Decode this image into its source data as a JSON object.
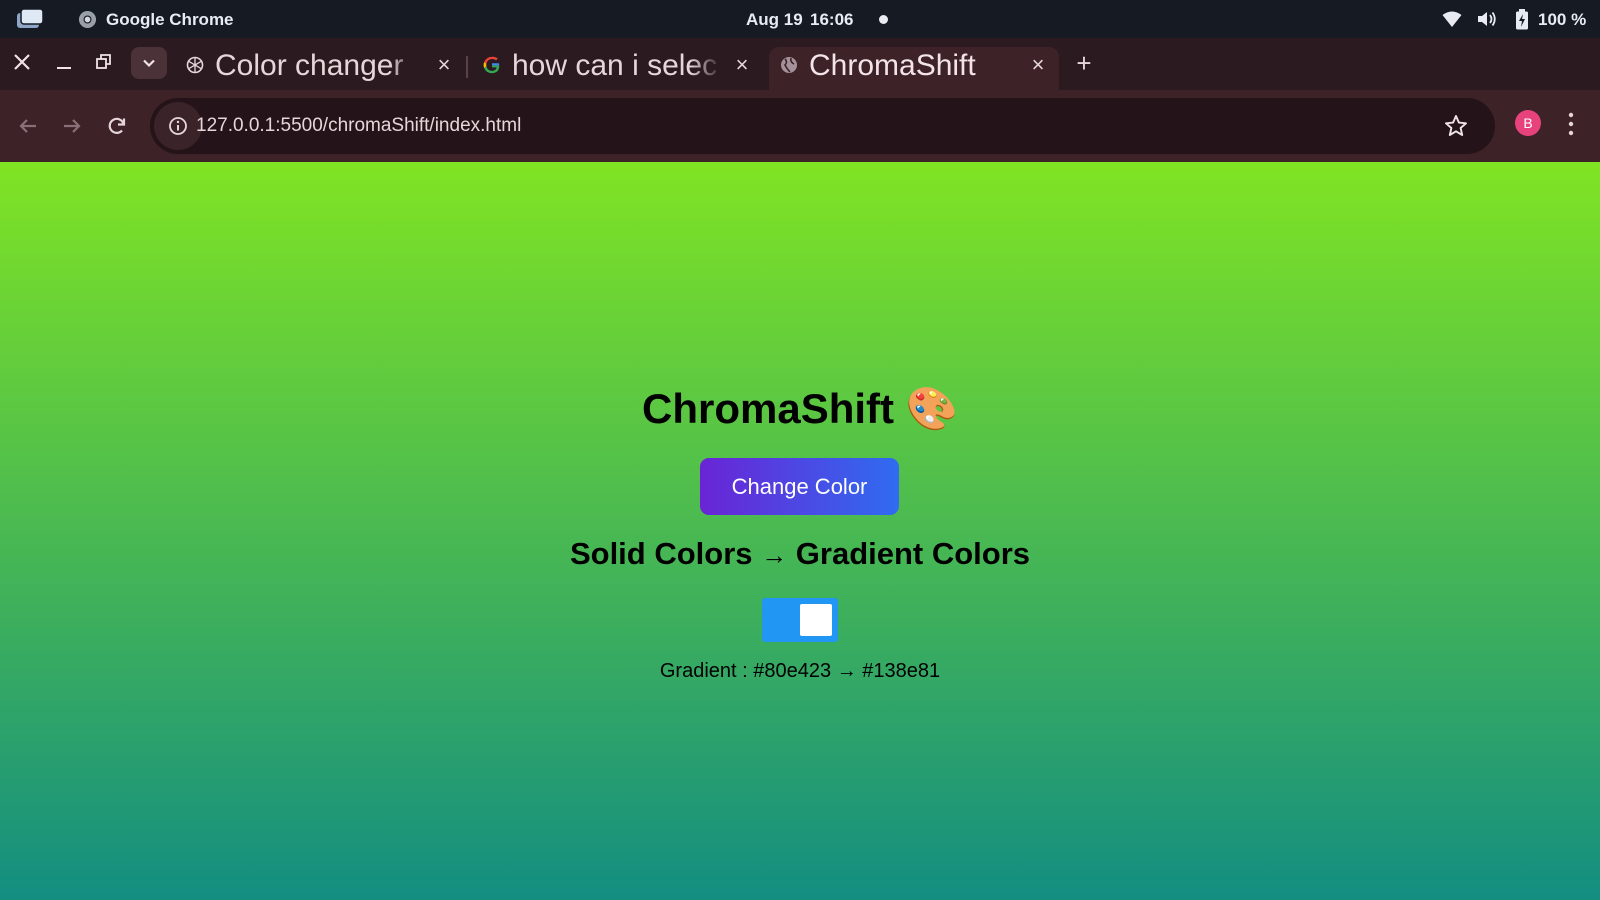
{
  "os_bar": {
    "app_name": "Google Chrome",
    "date": "Aug 19",
    "time": "16:06",
    "battery": "100 %",
    "icons": [
      "window-switcher-icon",
      "chrome-icon",
      "wifi-icon",
      "volume-icon",
      "battery-icon"
    ]
  },
  "tabs": [
    {
      "title": "Color changer",
      "favicon": "openai-icon",
      "active": false
    },
    {
      "title": "how can i selec",
      "favicon": "google-icon",
      "active": false
    },
    {
      "title": "ChromaShift",
      "favicon": "globe-icon",
      "active": true
    }
  ],
  "toolbar": {
    "url": "127.0.0.1:5500/chromaShift/index.html",
    "profile_initial": "B",
    "profile_color": "#e8427c"
  },
  "page": {
    "title": "ChromaShift",
    "title_emoji": "🎨",
    "button_label": "Change Color",
    "button_gradient": [
      "#6a24d6",
      "#2f6cf0"
    ],
    "mode_left": "Solid Colors",
    "mode_arrow": "→",
    "mode_right": "Gradient Colors",
    "toggle_on": true,
    "toggle_color": "#2196f3",
    "gradient_prefix": "Gradient :",
    "gradient_start": "#80e423",
    "gradient_arrow": "→",
    "gradient_end": "#138e81"
  }
}
